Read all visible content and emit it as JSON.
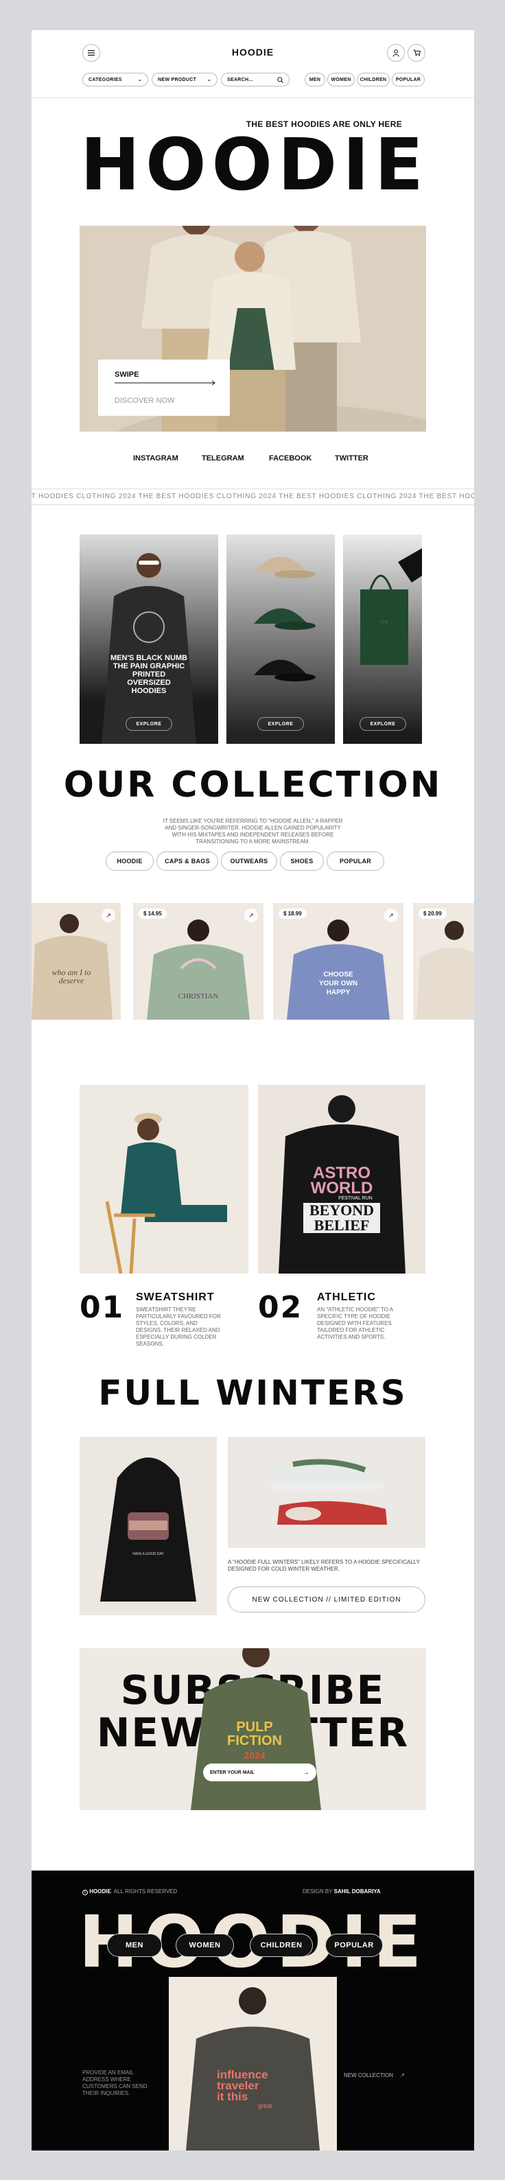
{
  "header": {
    "logo": "HOODIE",
    "menu_icon": "menu-icon",
    "user_icon": "user-icon",
    "cart_icon": "cart-icon"
  },
  "filters": {
    "categories": "CATEGORIES",
    "new_product": "NEW PRODUCT",
    "search_placeholder": "SEARCH...",
    "chips": [
      "MEN",
      "WOMEN",
      "CHILDREN",
      "POPULAR"
    ]
  },
  "hero": {
    "tagline": "THE BEST HOODIES ARE ONLY HERE",
    "title": "HOODIE",
    "swipe": "SWIPE",
    "discover": "DISCOVER NOW"
  },
  "social": [
    "INSTAGRAM",
    "TELEGRAM",
    "FACEBOOK",
    "TWITTER"
  ],
  "marquee": "IT HOODIES CLOTHING 2024 THE BEST HOODIES CLOTHING 2024 THE BEST HOODIES CLOTHING 2024 THE BEST HOODIES CLOTHING 2024 THE",
  "featured": {
    "card1_title": "MEN'S BLACK NUMB THE PAIN GRAPHIC PRINTED OVERSIZED HOODIES",
    "explore": "EXPLORE"
  },
  "collection": {
    "title": "OUR COLLECTION",
    "description": "IT SEEMS LIKE YOU'RE REFERRING TO \"HOODIE ALLEN,\" A RAPPER AND SINGER-SONGWRITER. HOODIE ALLEN GAINED POPULARITY WITH HIS MIXTAPES AND INDEPENDENT RELEASES BEFORE TRANSITIONING TO A MORE MAINSTREAM.",
    "tabs": [
      "HOODIE",
      "CAPS & BAGS",
      "OUTWEARS",
      "SHOES",
      "POPULAR"
    ]
  },
  "products": [
    {
      "price": "",
      "print": "who am I to deserve",
      "color": "#d8c7ad"
    },
    {
      "price": "$ 14.95",
      "print": "CHRISTIAN",
      "color": "#9bb39d"
    },
    {
      "price": "$ 18.99",
      "print": "CHOOSE YOUR OWN HAPPY",
      "color": "#7d8fc2"
    },
    {
      "price": "$ 20.99",
      "print": "",
      "color": "#e6ddd0"
    }
  ],
  "highlights": [
    {
      "num": "01",
      "title": "SWEATSHIRT",
      "text": "SWEATSHIRT THEY'RE PARTICULARLY FAVOURED FOR STYLES, COLORS, AND DESIGNS. THEIR RELAXED AND ESPECIALLY DURING COLDER SEASONS."
    },
    {
      "num": "02",
      "title": "ATHLETIC",
      "text": "AN \"ATHLETIC HOODIE\" TO A SPECIFIC TYPE OF HOODIE DESIGNED WITH FEATURES TAILORED FOR ATHLETIC ACTIVITIES AND SPORTS."
    }
  ],
  "astro_print": [
    "ASTRO",
    "WORLD",
    "FESTIVAL RUN",
    "BEYOND",
    "BELIEF"
  ],
  "winters": {
    "title": "FULL WINTERS",
    "text": "A \"HOODIE FULL WINTERS\" LIKELY REFERS TO A HOODIE SPECIFICALLY DESIGNED FOR COLD WINTER WEATHER.",
    "button": "NEW COLLECTION // LIMITED EDITION",
    "hoodie_print": "HAVE A GOOD DAY"
  },
  "subscribe": {
    "line1": "SUBSCRIBE OUR",
    "line2": "NEWSLETTER",
    "placeholder": "ENTER YOUR MAIL",
    "print": [
      "PULP",
      "FICTION",
      "2024"
    ]
  },
  "footer": {
    "copyright_brand": "HOODIE",
    "copyright_rest": ". ALL RIGHTS RESERVED",
    "design_by": "DESIGN BY",
    "designer": "SAHIL DOBARIYA",
    "big": "HOODIE",
    "chips": [
      "MEN",
      "WOMEN",
      "CHILDREN",
      "POPULAR"
    ],
    "note": "PROVIDE AN EMAIL ADDRESS WHERE CUSTOMERS CAN SEND THEIR INQUIRIES.",
    "new_collection": "NEW COLLECTION",
    "print": [
      "influence",
      "traveler",
      "it this",
      "great"
    ]
  },
  "colors": {
    "accent": "#0b0b0b",
    "bg": "#ffffff",
    "frame": "#d8d9dd",
    "beige": "#e8e0d3"
  }
}
